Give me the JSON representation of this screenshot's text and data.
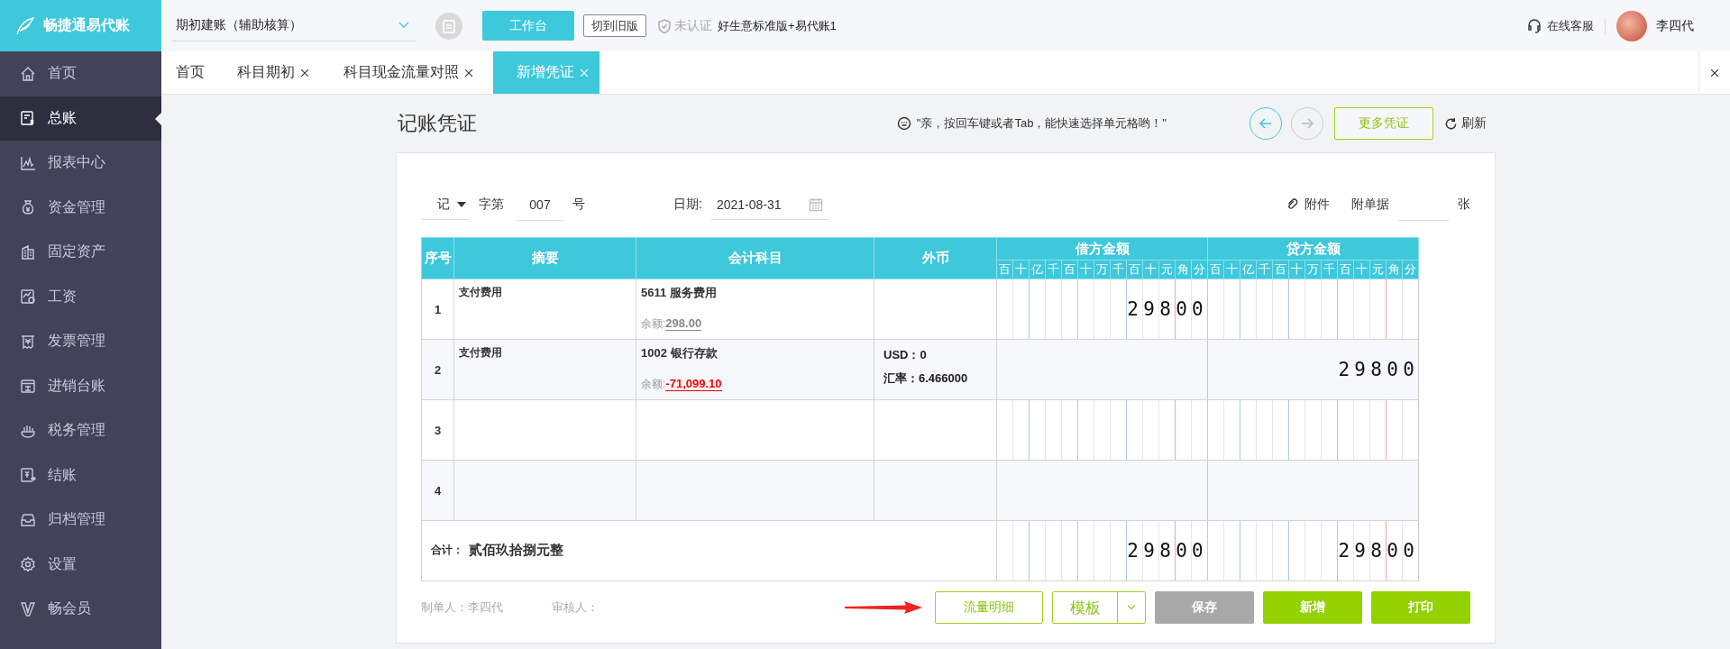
{
  "logo": {
    "text": "畅捷通易代账"
  },
  "sidebar": {
    "items": [
      {
        "label": "首页",
        "selected": false
      },
      {
        "label": "总账",
        "selected": true
      },
      {
        "label": "报表中心",
        "selected": false
      },
      {
        "label": "资金管理",
        "selected": false
      },
      {
        "label": "固定资产",
        "selected": false
      },
      {
        "label": "工资",
        "selected": false
      },
      {
        "label": "发票管理",
        "selected": false
      },
      {
        "label": "进销台账",
        "selected": false
      },
      {
        "label": "税务管理",
        "selected": false
      },
      {
        "label": "结账",
        "selected": false
      },
      {
        "label": "归档管理",
        "selected": false
      },
      {
        "label": "设置",
        "selected": false
      },
      {
        "label": "畅会员",
        "selected": false
      }
    ]
  },
  "topbar": {
    "book_select": "期初建账（辅助核算）",
    "workbench_button": "工作台",
    "old_version_button": "切到旧版",
    "cert_badge": "未认证",
    "product": "好生意标准版+易代账1",
    "support": "在线客服",
    "user": "李四代"
  },
  "tabs": [
    {
      "label": "首页",
      "selected": false,
      "closable": false
    },
    {
      "label": "科目期初",
      "selected": false,
      "closable": true
    },
    {
      "label": "科目现金流量对照",
      "selected": false,
      "closable": true
    },
    {
      "label": "新增凭证",
      "selected": true,
      "closable": true
    }
  ],
  "voucher": {
    "title": "记账凭证",
    "tip": "\"亲，按回车键或者Tab，能快速选择单元格哟！\"",
    "nav": [
      {
        "kind": "back",
        "disabled": false
      },
      {
        "kind": "forward",
        "disabled": true
      }
    ],
    "more_button": "更多凭证",
    "refresh": "刷新",
    "type": "记",
    "prefix": "字第",
    "number": "007",
    "suffix": "号",
    "date_label": "日期:",
    "date": "2021-08-31",
    "attach": "附件",
    "docs_label": "附单据",
    "docs_unit": "张"
  },
  "table": {
    "columns": [
      "序号",
      "摘要",
      "会计科目",
      "外币"
    ],
    "amount_groups": [
      {
        "title": "借方金额",
        "units": [
          "百",
          "十",
          "亿",
          "千",
          "百",
          "十",
          "万",
          "千",
          "百",
          "十",
          "元",
          "角",
          "分"
        ]
      },
      {
        "title": "贷方金额",
        "units": [
          "百",
          "十",
          "亿",
          "千",
          "百",
          "十",
          "万",
          "千",
          "百",
          "十",
          "元",
          "角",
          "分"
        ]
      }
    ],
    "rows": [
      {
        "seq": "1",
        "summary": "支付费用",
        "account": "5611 服务费用",
        "balance_label": "余额:",
        "balance": "298.00",
        "negative": false,
        "currency": [],
        "debit": "29800",
        "credit": ""
      },
      {
        "seq": "2",
        "summary": "支付费用",
        "account": "1002 银行存款",
        "balance_label": "余额:",
        "balance": "-71,099.10",
        "negative": true,
        "currency": [
          "USD：0",
          "汇率：6.466000"
        ],
        "debit": "",
        "credit": "29800"
      },
      {
        "seq": "3"
      },
      {
        "seq": "4"
      }
    ],
    "total": {
      "label": "合计：",
      "text": "贰佰玖拾捌元整",
      "debit": "29800",
      "credit": "29800"
    }
  },
  "footer": {
    "maker": "制单人：李四代",
    "reviewer": "审核人：",
    "buttons": [
      {
        "label": "流量明细",
        "kind": "outline",
        "disabled": false
      },
      {
        "label": "模板",
        "kind": "split",
        "disabled": false
      },
      {
        "label": "保存",
        "kind": "primary",
        "disabled": true
      },
      {
        "label": "新增",
        "kind": "primary",
        "disabled": false
      },
      {
        "label": "打印",
        "kind": "primary",
        "disabled": false
      }
    ]
  }
}
